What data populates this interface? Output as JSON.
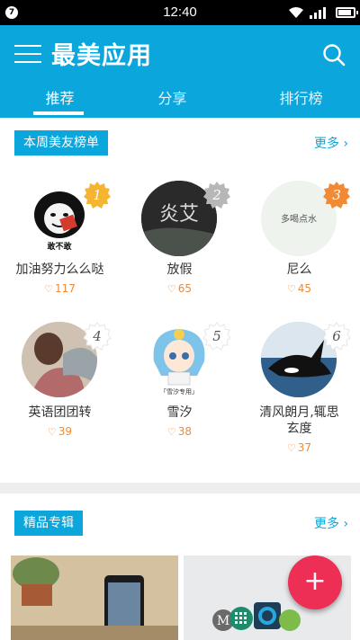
{
  "status_bar": {
    "notification": "7",
    "time": "12:40",
    "battery_level": 0.85
  },
  "app": {
    "title": "最美应用"
  },
  "tabs": [
    {
      "label": "推荐",
      "active": true
    },
    {
      "label": "分享",
      "active": false
    },
    {
      "label": "排行榜",
      "active": false
    }
  ],
  "weekly": {
    "tag": "本周美友榜单",
    "more": "更多",
    "friends": [
      {
        "rank": "1",
        "name": "加油努力么么哒",
        "count": "117",
        "rank_color": "#f5b431"
      },
      {
        "rank": "2",
        "name": "放假",
        "count": "65",
        "rank_color": "#b7b7b7"
      },
      {
        "rank": "3",
        "name": "尼么",
        "count": "45",
        "rank_color": "#f08a35"
      },
      {
        "rank": "4",
        "name": "英语团团转",
        "count": "39",
        "rank_color": "#ffffff"
      },
      {
        "rank": "5",
        "name": "雪汐",
        "count": "38",
        "rank_color": "#ffffff"
      },
      {
        "rank": "6",
        "name": "清风朗月,辄思\n玄度",
        "count": "37",
        "rank_color": "#ffffff"
      }
    ],
    "avatar_texts": {
      "a1": "敢不敢",
      "a2": "炎艾",
      "a3": "多喝点水",
      "a5": "「雪汐专用」"
    }
  },
  "featured": {
    "tag": "精品专辑",
    "more": "更多",
    "thumb2_letter": "M"
  },
  "colors": {
    "primary": "#0aa6dc",
    "accent": "#ee2f55",
    "count": "#f08a35"
  }
}
